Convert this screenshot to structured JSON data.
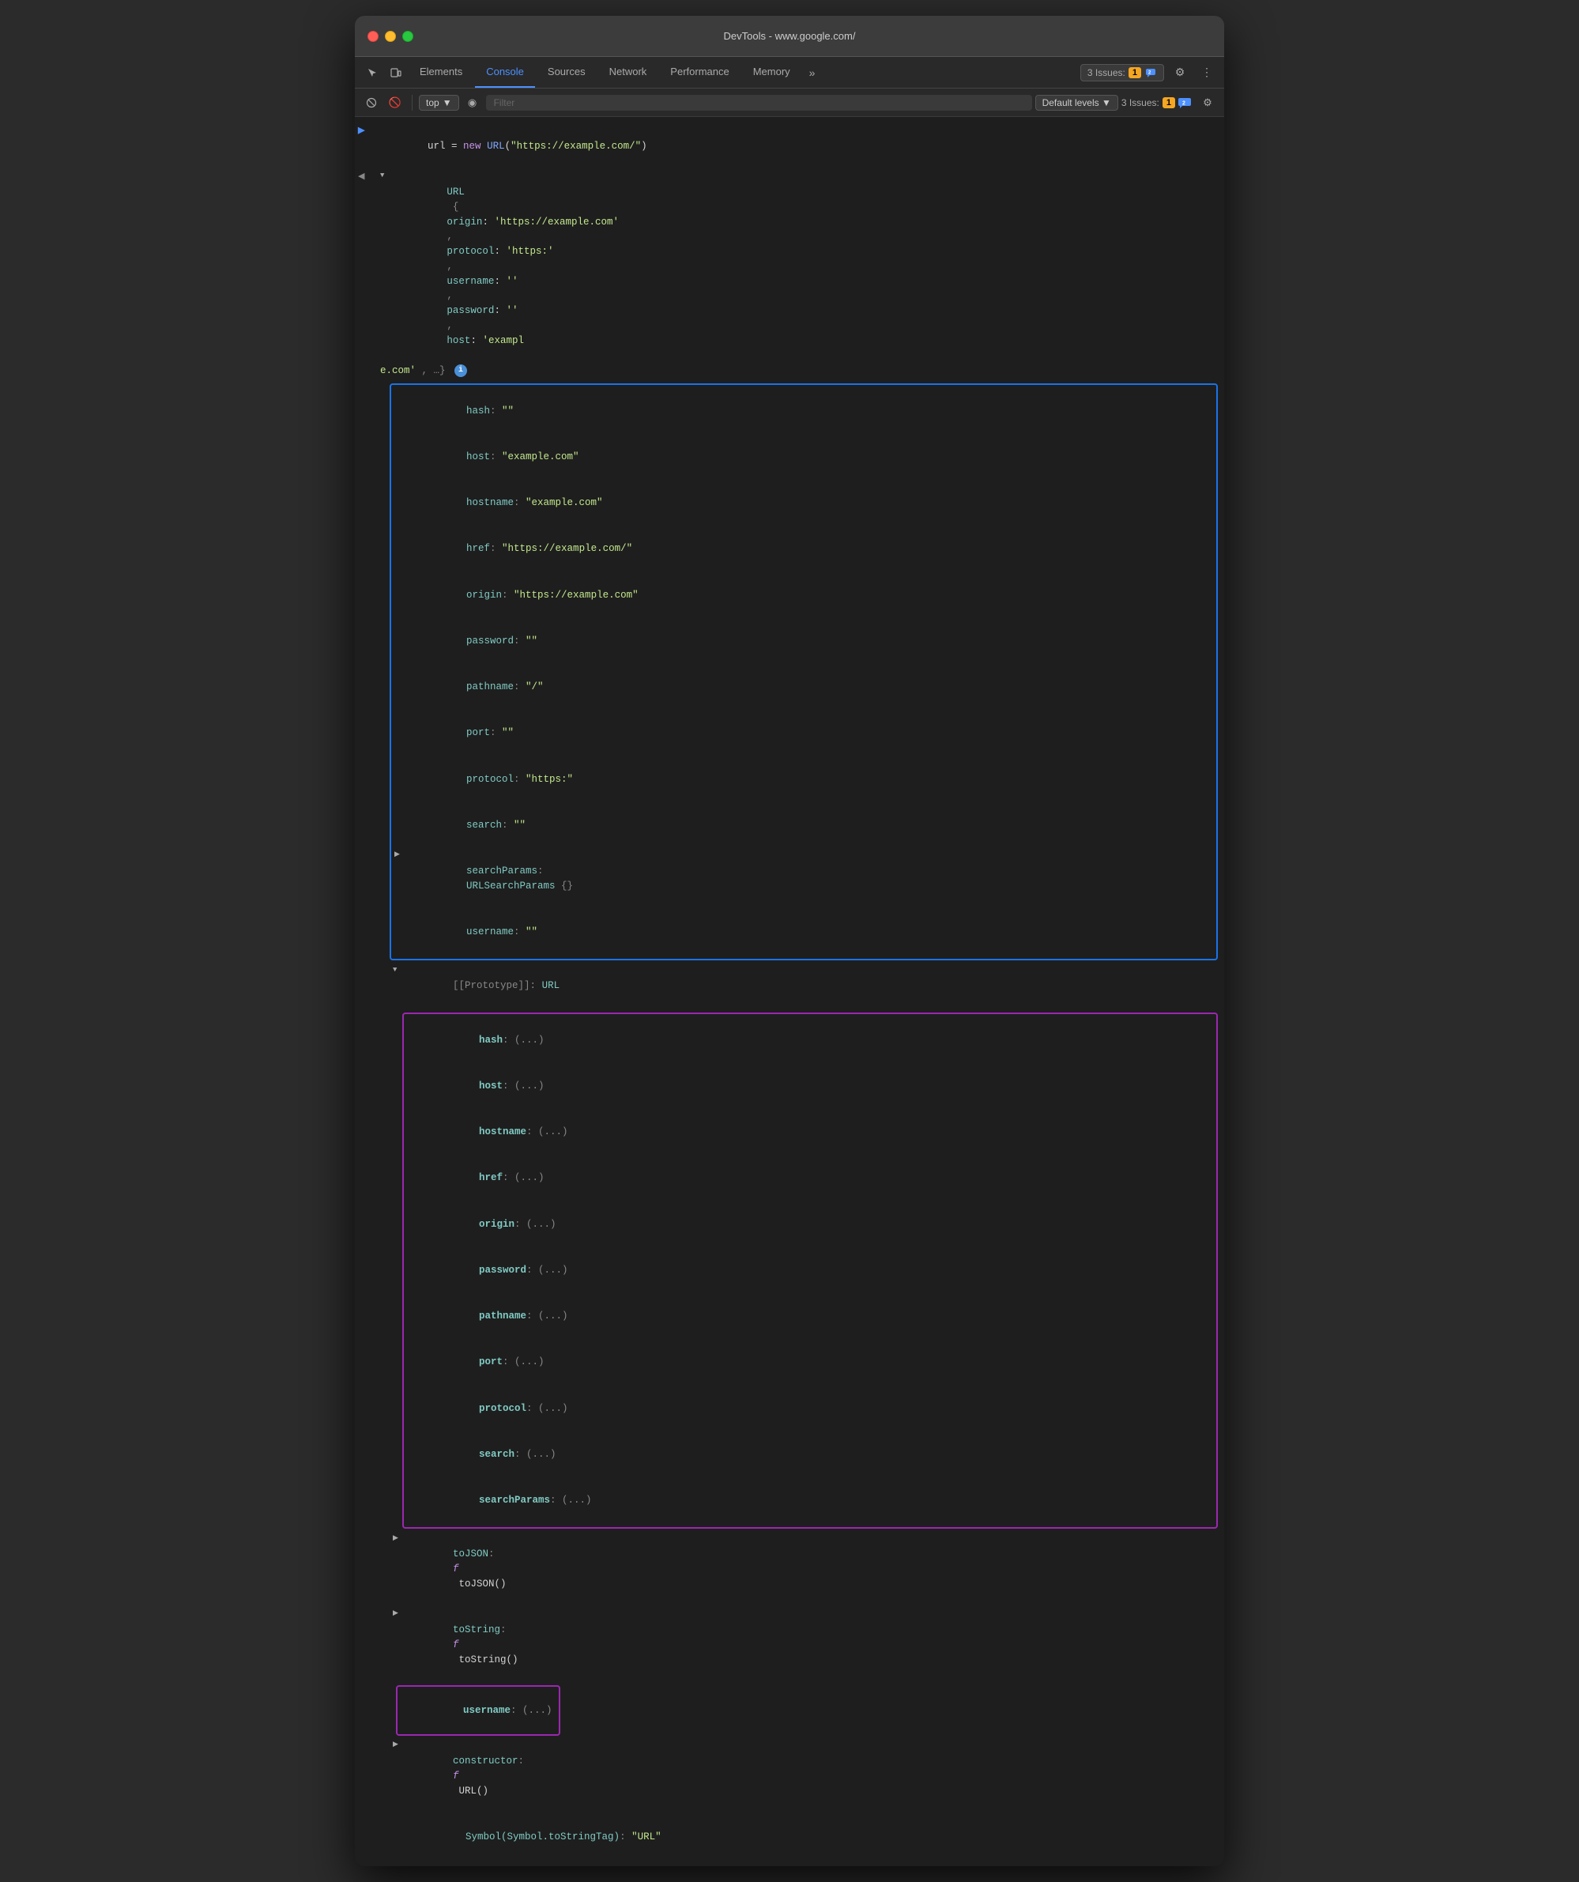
{
  "window": {
    "title": "DevTools - www.google.com/"
  },
  "tabs": {
    "items": [
      {
        "id": "elements",
        "label": "Elements",
        "active": false
      },
      {
        "id": "console",
        "label": "Console",
        "active": true
      },
      {
        "id": "sources",
        "label": "Sources",
        "active": false
      },
      {
        "id": "network",
        "label": "Network",
        "active": false
      },
      {
        "id": "performance",
        "label": "Performance",
        "active": false
      },
      {
        "id": "memory",
        "label": "Memory",
        "active": false
      }
    ],
    "more_label": "»",
    "issues_label": "3 Issues:",
    "issues_count_yellow": "1",
    "issues_count_blue": "2"
  },
  "toolbar": {
    "top_label": "top",
    "filter_placeholder": "Filter",
    "levels_label": "Default levels ▼"
  },
  "console": {
    "line1": "url = new URL(\"https://example.com/\")",
    "url_obj_prefix": "URL {",
    "url_obj_origin": "origin: 'https://example.com'",
    "url_obj_protocol": "protocol: 'https:'",
    "url_obj_username": "username: ''",
    "url_obj_password": "password: ''",
    "url_obj_host": "host: 'example.com'",
    "url_obj_suffix": ", …}",
    "url_instance_fields": [
      {
        "key": "hash:",
        "value": "\"\""
      },
      {
        "key": "host:",
        "value": "\"example.com\""
      },
      {
        "key": "hostname:",
        "value": "\"example.com\""
      },
      {
        "key": "href:",
        "value": "\"https://example.com/\""
      },
      {
        "key": "origin:",
        "value": "\"https://example.com\""
      },
      {
        "key": "password:",
        "value": "\"\""
      },
      {
        "key": "pathname:",
        "value": "\"/\""
      },
      {
        "key": "port:",
        "value": "\"\""
      },
      {
        "key": "protocol:",
        "value": "\"https:\""
      },
      {
        "key": "search:",
        "value": "\"\""
      }
    ],
    "searchparams_label": "searchParams:",
    "searchparams_value": "URLSearchParams {}",
    "username_instance": "username:",
    "username_value": "\"\"",
    "prototype_label": "[[Prototype]]:",
    "prototype_value": "URL",
    "prototype_fields": [
      {
        "key": "hash:",
        "value": "(...)"
      },
      {
        "key": "host:",
        "value": "(...)"
      },
      {
        "key": "hostname:",
        "value": "(...)"
      },
      {
        "key": "href:",
        "value": "(...)"
      },
      {
        "key": "origin:",
        "value": "(...)"
      },
      {
        "key": "password:",
        "value": "(...)"
      },
      {
        "key": "pathname:",
        "value": "(...)"
      },
      {
        "key": "port:",
        "value": "(...)"
      },
      {
        "key": "protocol:",
        "value": "(...)"
      },
      {
        "key": "search:",
        "value": "(...)"
      },
      {
        "key": "searchParams:",
        "value": "(...)"
      }
    ],
    "tojson_label": "toJSON:",
    "tojson_value": "f toJSON()",
    "tostring_label": "toString:",
    "tostring_value": "f toString()",
    "username_proto_label": "username:",
    "username_proto_value": "(...)",
    "constructor_label": "constructor:",
    "constructor_value": "f URL()",
    "symbol_label": "Symbol(Symbol.toStringTag):",
    "symbol_value": "\"URL\""
  },
  "colors": {
    "accent_blue": "#1a73e8",
    "accent_purple": "#9c27b0",
    "string_green": "#c3e88d",
    "keyword_purple": "#c792ea",
    "prop_teal": "#80cbc4"
  }
}
